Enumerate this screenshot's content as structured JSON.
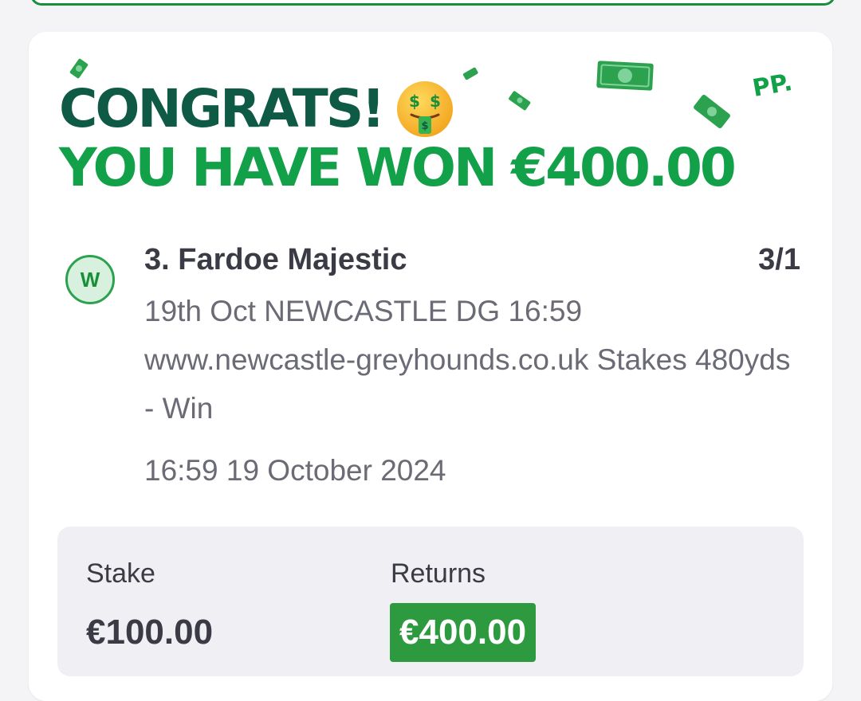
{
  "banner": {
    "congrats": "CONGRATS!",
    "emoji_icon": "money-mouth-face-icon",
    "won_text": "YOU HAVE WON €400.00",
    "brand_mark": "PP."
  },
  "bet": {
    "status_badge": "W",
    "selection": "3. Fardoe Majestic",
    "odds": "3/1",
    "event_description": "19th Oct NEWCASTLE DG 16:59 www.newcastle-greyhounds.co.uk Stakes 480yds - Win",
    "event_datetime": "16:59 19 October 2024"
  },
  "summary": {
    "stake_label": "Stake",
    "stake_value": "€100.00",
    "returns_label": "Returns",
    "returns_value": "€400.00"
  },
  "colors": {
    "dark_green": "#0e5a45",
    "brand_green": "#12a048",
    "returns_green": "#2e9a3f"
  }
}
